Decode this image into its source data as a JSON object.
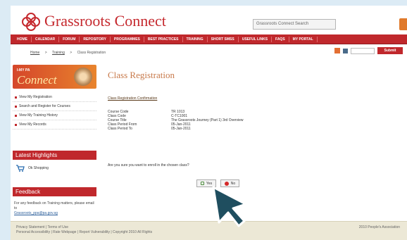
{
  "header": {
    "logo_text": "Grassroots Connect",
    "search_placeholder": "Grassroots Connect Search"
  },
  "nav": {
    "items": [
      "HOME",
      "CALENDAR",
      "FORUM",
      "REPOSITORY",
      "PROGRAMMES",
      "BEST PRACTICES",
      "TRAINING",
      "SHORT SMSS",
      "USEFUL LINKS",
      "FAQS",
      "MY PORTAL"
    ]
  },
  "breadcrumb": {
    "items": [
      "Home",
      "Training",
      "Class Registration"
    ]
  },
  "tools": {
    "field_text": "",
    "button_label": "Submit"
  },
  "sidebar": {
    "banner_small": "I-MY PA",
    "banner_big": "Connect",
    "menu": [
      "View My Registration",
      "Search and Register for Courses",
      "View My Training History",
      "View My Records"
    ],
    "highlights_title": "Latest Highlights",
    "cart_label": "Ok Shopping",
    "feedback_title": "Feedback",
    "feedback_text": "For any feedback on Training matters, please email to",
    "feedback_email": "Grassroots_ppa@pa.gov.sg"
  },
  "content": {
    "title": "Class Registration",
    "confirm_link": "Class Registration Confirmation",
    "details": [
      {
        "label": "Course Code",
        "value": "TR 1013"
      },
      {
        "label": "Class Code",
        "value": "C-TC1001"
      },
      {
        "label": "Course Title",
        "value": "The Grassroots Journey (Part 1) 3rd Overview"
      },
      {
        "label": "Class Period From",
        "value": "05-Jan-2011"
      },
      {
        "label": "Class Period To",
        "value": "05-Jan-2011"
      }
    ],
    "question": "Are you sure you want to enroll in the chosen class?",
    "yes_label": "Yes",
    "no_label": "No"
  },
  "footer": {
    "left_line1": "Privacy Statement | Terms of Use",
    "left_line2": "Personal Accessibility | Rate Webpage | Report Vulnerability | Copyright 2010 All Rights",
    "right": "2010 People's Association"
  },
  "colors": {
    "brand_red": "#c0282c",
    "title_orange": "#c87a4b",
    "cursor_teal": "#1f4e5f"
  }
}
